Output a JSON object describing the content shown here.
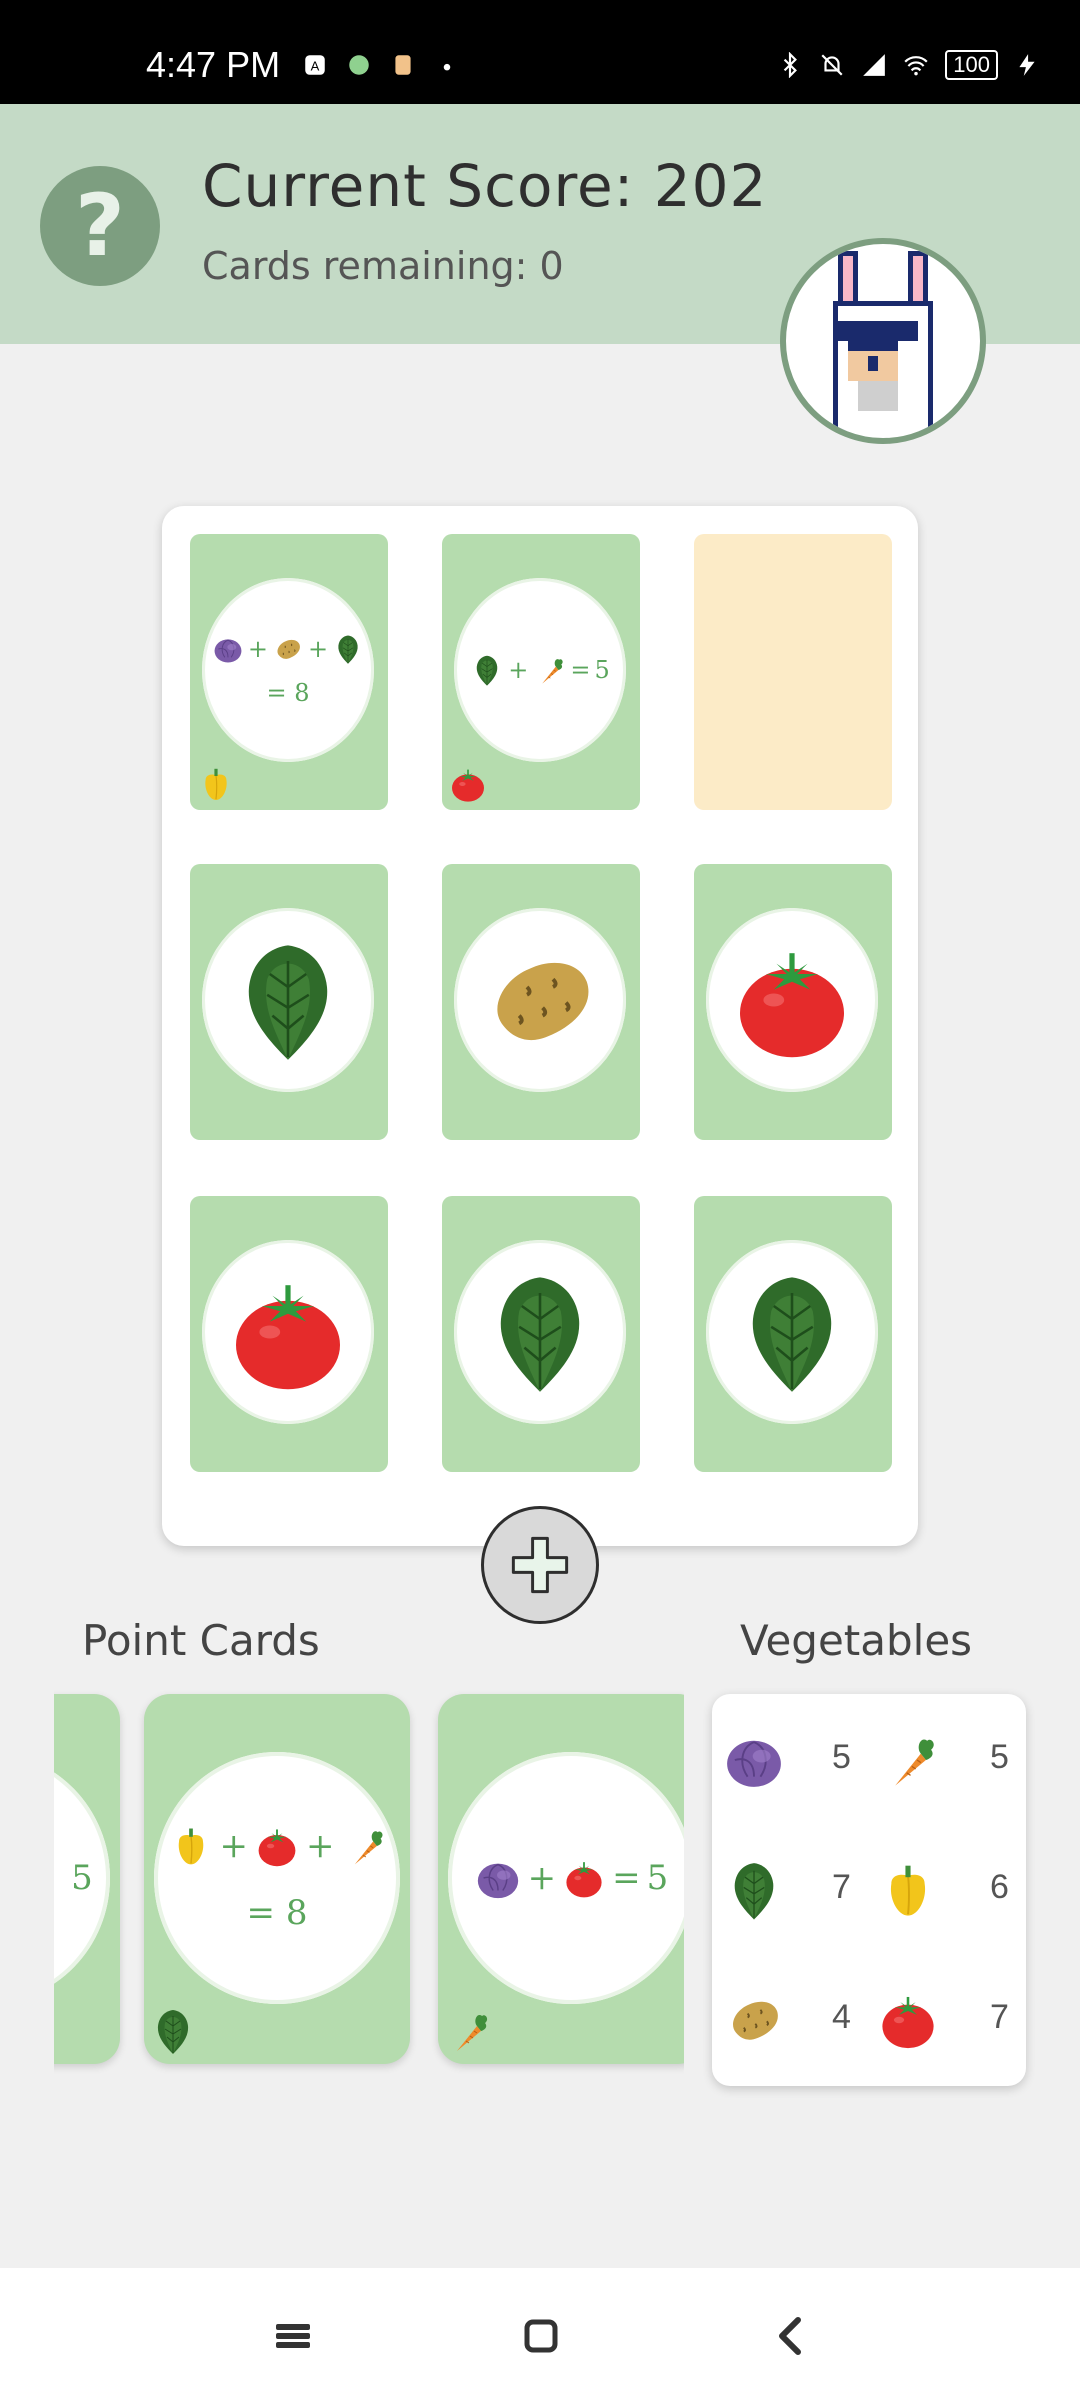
{
  "status_bar": {
    "time": "4:47 PM",
    "battery": "100"
  },
  "header": {
    "score_text": "Current Score: 202",
    "remaining_text": "Cards remaining: 0",
    "help_symbol": "?"
  },
  "board": {
    "cards": [
      {
        "type": "point",
        "formula": [
          "cabbage",
          "+",
          "potato",
          "+",
          "lettuce"
        ],
        "result": "= 8",
        "corner": "pepper"
      },
      {
        "type": "point",
        "formula": [
          "lettuce",
          "+",
          "carrot",
          "=",
          "5"
        ],
        "corner": "tomato"
      },
      {
        "type": "empty"
      },
      {
        "type": "veg",
        "veg": "lettuce"
      },
      {
        "type": "veg",
        "veg": "potato"
      },
      {
        "type": "veg",
        "veg": "tomato"
      },
      {
        "type": "veg",
        "veg": "tomato"
      },
      {
        "type": "veg",
        "veg": "lettuce"
      },
      {
        "type": "veg",
        "veg": "lettuce"
      }
    ],
    "add_button": "add-card"
  },
  "point_cards_section": {
    "label": "Point Cards",
    "partial_card_text": "5",
    "card1": {
      "formula": [
        "pepper",
        "+",
        "tomato",
        "+",
        "carrot"
      ],
      "result": "= 8",
      "corner": "lettuce"
    },
    "card2": {
      "formula": [
        "cabbage",
        "+",
        "tomato",
        "=",
        "5"
      ],
      "corner": "carrot"
    }
  },
  "vegetables_section": {
    "label": "Vegetables",
    "items": [
      {
        "veg": "cabbage",
        "count": "5"
      },
      {
        "veg": "carrot",
        "count": "5"
      },
      {
        "veg": "lettuce",
        "count": "7"
      },
      {
        "veg": "pepper",
        "count": "6"
      },
      {
        "veg": "potato",
        "count": "4"
      },
      {
        "veg": "tomato",
        "count": "7"
      }
    ]
  },
  "icons": {
    "cabbage": "cabbage-icon",
    "potato": "potato-icon",
    "lettuce": "lettuce-icon",
    "carrot": "carrot-icon",
    "tomato": "tomato-icon",
    "pepper": "pepper-icon"
  },
  "colors": {
    "header_bg": "#c4dac6",
    "card_green": "#b5dcae",
    "empty_slot": "#fcebc7",
    "formula_green": "#5aa55c",
    "help_button": "#7d9e80"
  }
}
